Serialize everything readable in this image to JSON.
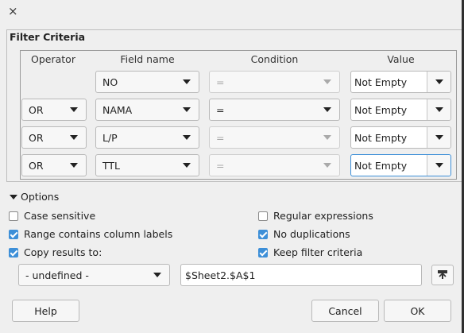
{
  "dialog": {
    "close_glyph": "×"
  },
  "filter_criteria": {
    "title": "Filter Criteria",
    "headers": {
      "operator": "Operator",
      "field_name": "Field name",
      "condition": "Condition",
      "value": "Value"
    },
    "rows": [
      {
        "operator": "",
        "field": "NO",
        "condition": "=",
        "value": "Not Empty",
        "condition_enabled": false
      },
      {
        "operator": "OR",
        "field": "NAMA",
        "condition": "=",
        "value": "Not Empty",
        "condition_enabled": true
      },
      {
        "operator": "OR",
        "field": "L/P",
        "condition": "=",
        "value": "Not Empty",
        "condition_enabled": false
      },
      {
        "operator": "OR",
        "field": "TTL",
        "condition": "=",
        "value": "Not Empty",
        "condition_enabled": false
      }
    ]
  },
  "options": {
    "label": "Options",
    "case_sensitive": {
      "label": "Case sensitive",
      "checked": false
    },
    "range_contains_labels": {
      "label": "Range contains column labels",
      "checked": true
    },
    "copy_results_to": {
      "label": "Copy results to:",
      "checked": true
    },
    "regular_expressions": {
      "label": "Regular expressions",
      "checked": false
    },
    "no_duplications": {
      "label": "No duplications",
      "checked": true
    },
    "keep_filter_criteria": {
      "label": "Keep filter criteria",
      "checked": true
    },
    "copy_target_select": "- undefined -",
    "copy_target_field": "$Sheet2.$A$1"
  },
  "buttons": {
    "help": "Help",
    "cancel": "Cancel",
    "ok": "OK"
  },
  "colors": {
    "accent": "#3d8fd8",
    "background": "#efefef"
  },
  "icons": {
    "shrink": "shrink-icon",
    "close": "close-icon"
  }
}
